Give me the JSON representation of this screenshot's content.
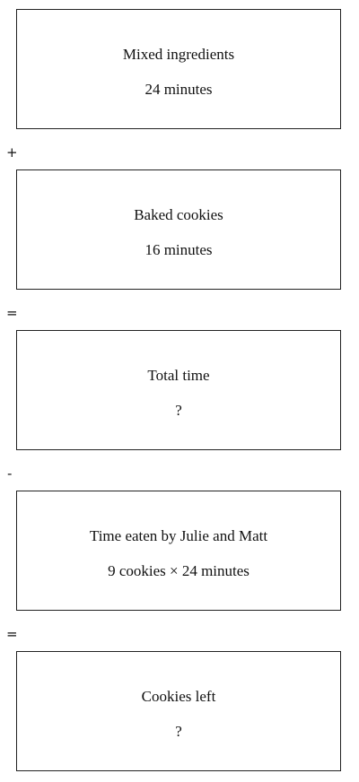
{
  "boxes": [
    {
      "title": "Mixed ingredients",
      "value": "24 minutes"
    },
    {
      "title": "Baked cookies",
      "value": "16 minutes"
    },
    {
      "title": "Total time",
      "value": "?"
    },
    {
      "title": "Time eaten by Julie and Matt",
      "value": "9 cookies × 24 minutes"
    },
    {
      "title": "Cookies left",
      "value": "?"
    }
  ],
  "operators": [
    "+",
    "=",
    "-",
    "="
  ]
}
